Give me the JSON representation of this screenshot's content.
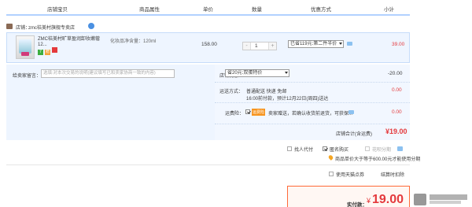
{
  "header": {
    "col_shop": "店铺宝贝",
    "col_attr": "商品属性",
    "col_price": "单价",
    "col_qty": "数量",
    "col_promo": "优惠方式",
    "col_subtotal": "小计"
  },
  "shop": {
    "label": "店铺：",
    "name": "zmc桔美村旗舰专卖店"
  },
  "item": {
    "title": "ZMC桔美村旷草盈润洗面奶补水保湿控油深层清洁男女",
    "title_display": "ZMC桔美村旷草盈润卸妆嫩蓿12...",
    "attr": "化妆品净含量：120ml",
    "price": "158.00",
    "qty": "1",
    "qty_minus": "-",
    "qty_plus": "+",
    "promo": "已省119元:第二件半价",
    "subtotal": "39.00",
    "badge1": "7",
    "badge2": "赠"
  },
  "message": {
    "label": "给卖家留言：",
    "placeholder": "选填:对本次交易的说明(建议填写已和卖家协商一致的内容)"
  },
  "shop_promo": {
    "label": "店铺优惠：",
    "value": "省20元:双蛋特价",
    "amount": "-20.00"
  },
  "shipping": {
    "label": "运送方式：",
    "line1": "普通配送 快递 免邮",
    "line2": "16:00前付款，预计12月22日(周四)送达",
    "amount": "0.00"
  },
  "insurance": {
    "label": "运费险：",
    "badge": "运费险",
    "text": "卖家赠送，若确认收货前退货，可获保...",
    "amount": "0.00"
  },
  "total": {
    "label": "店铺合计(含运费)",
    "value": "¥19.00"
  },
  "options": {
    "anon_label": "找人代付",
    "anonymous_buy": "匿名购买",
    "flower_label": "花呗分期",
    "tmall_label": "商品单价大于等于600.00元才能使用分期",
    "points_label": "使用天猫点券",
    "installment": "结算时扣除"
  },
  "pay": {
    "label": "实付款：",
    "symbol": "¥",
    "value": "19.00"
  },
  "watermark": "值 什么值得买 / smzdm.com"
}
